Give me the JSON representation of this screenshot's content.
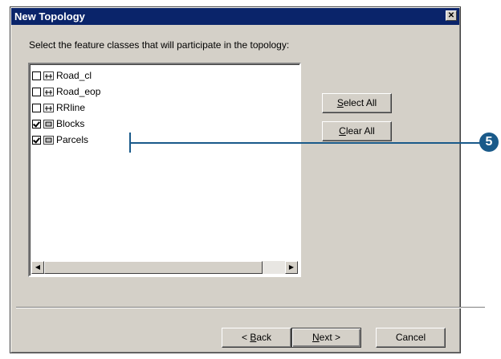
{
  "window": {
    "title": "New Topology"
  },
  "instruction": "Select the feature classes that will participate in the topology:",
  "list": {
    "items": [
      {
        "label": "Road_cl",
        "checked": false,
        "icon": "line-feature-class-icon"
      },
      {
        "label": "Road_eop",
        "checked": false,
        "icon": "line-feature-class-icon"
      },
      {
        "label": "RRline",
        "checked": false,
        "icon": "line-feature-class-icon"
      },
      {
        "label": "Blocks",
        "checked": true,
        "icon": "polygon-feature-class-icon"
      },
      {
        "label": "Parcels",
        "checked": true,
        "icon": "polygon-feature-class-icon"
      }
    ]
  },
  "buttons": {
    "select_all": {
      "key": "S",
      "rest": "elect All"
    },
    "clear_all": {
      "key": "C",
      "rest": "lear All"
    },
    "back": {
      "pre": "< ",
      "key": "B",
      "rest": "ack"
    },
    "next": {
      "key": "N",
      "rest": "ext >"
    },
    "cancel": "Cancel"
  },
  "callout": {
    "number": "5",
    "color": "#1a5a8a"
  },
  "colors": {
    "titlebar": "#0a246a",
    "dialog_face": "#d4d0c8"
  }
}
